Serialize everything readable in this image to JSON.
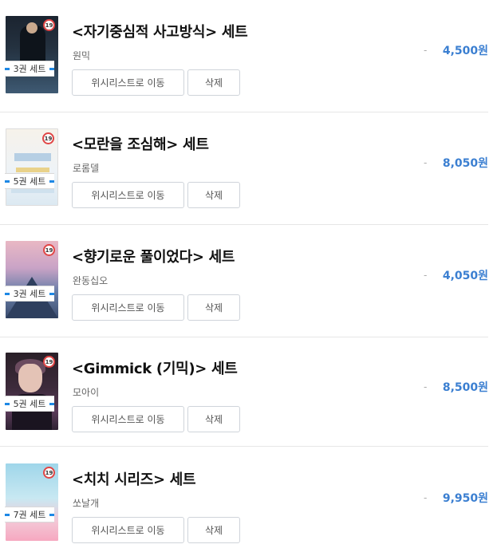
{
  "items": [
    {
      "title": "<자기중심적 사고방식> 세트",
      "author": "원믹",
      "set_badge": "3권 세트",
      "age": "19",
      "dash": "-",
      "price": "4,500원",
      "move_label": "위시리스트로 이동",
      "delete_label": "삭제"
    },
    {
      "title": "<모란을 조심해> 세트",
      "author": "로롬델",
      "set_badge": "5권 세트",
      "age": "19",
      "dash": "-",
      "price": "8,050원",
      "move_label": "위시리스트로 이동",
      "delete_label": "삭제"
    },
    {
      "title": "<향기로운 풀이었다> 세트",
      "author": "완동십오",
      "set_badge": "3권 세트",
      "age": "19",
      "dash": "-",
      "price": "4,050원",
      "move_label": "위시리스트로 이동",
      "delete_label": "삭제"
    },
    {
      "title": "<Gimmick (기믹)> 세트",
      "author": "모아이",
      "set_badge": "5권 세트",
      "age": "19",
      "dash": "-",
      "price": "8,500원",
      "move_label": "위시리스트로 이동",
      "delete_label": "삭제"
    },
    {
      "title": "<치치 시리즈> 세트",
      "author": "쏘날개",
      "set_badge": "7권 세트",
      "age": "19",
      "dash": "-",
      "price": "9,950원",
      "move_label": "위시리스트로 이동",
      "delete_label": "삭제"
    }
  ],
  "colors": {
    "accent": "#3b7fd1",
    "badge_ring": "#e04646",
    "badge_bar": "#1e88e5"
  }
}
